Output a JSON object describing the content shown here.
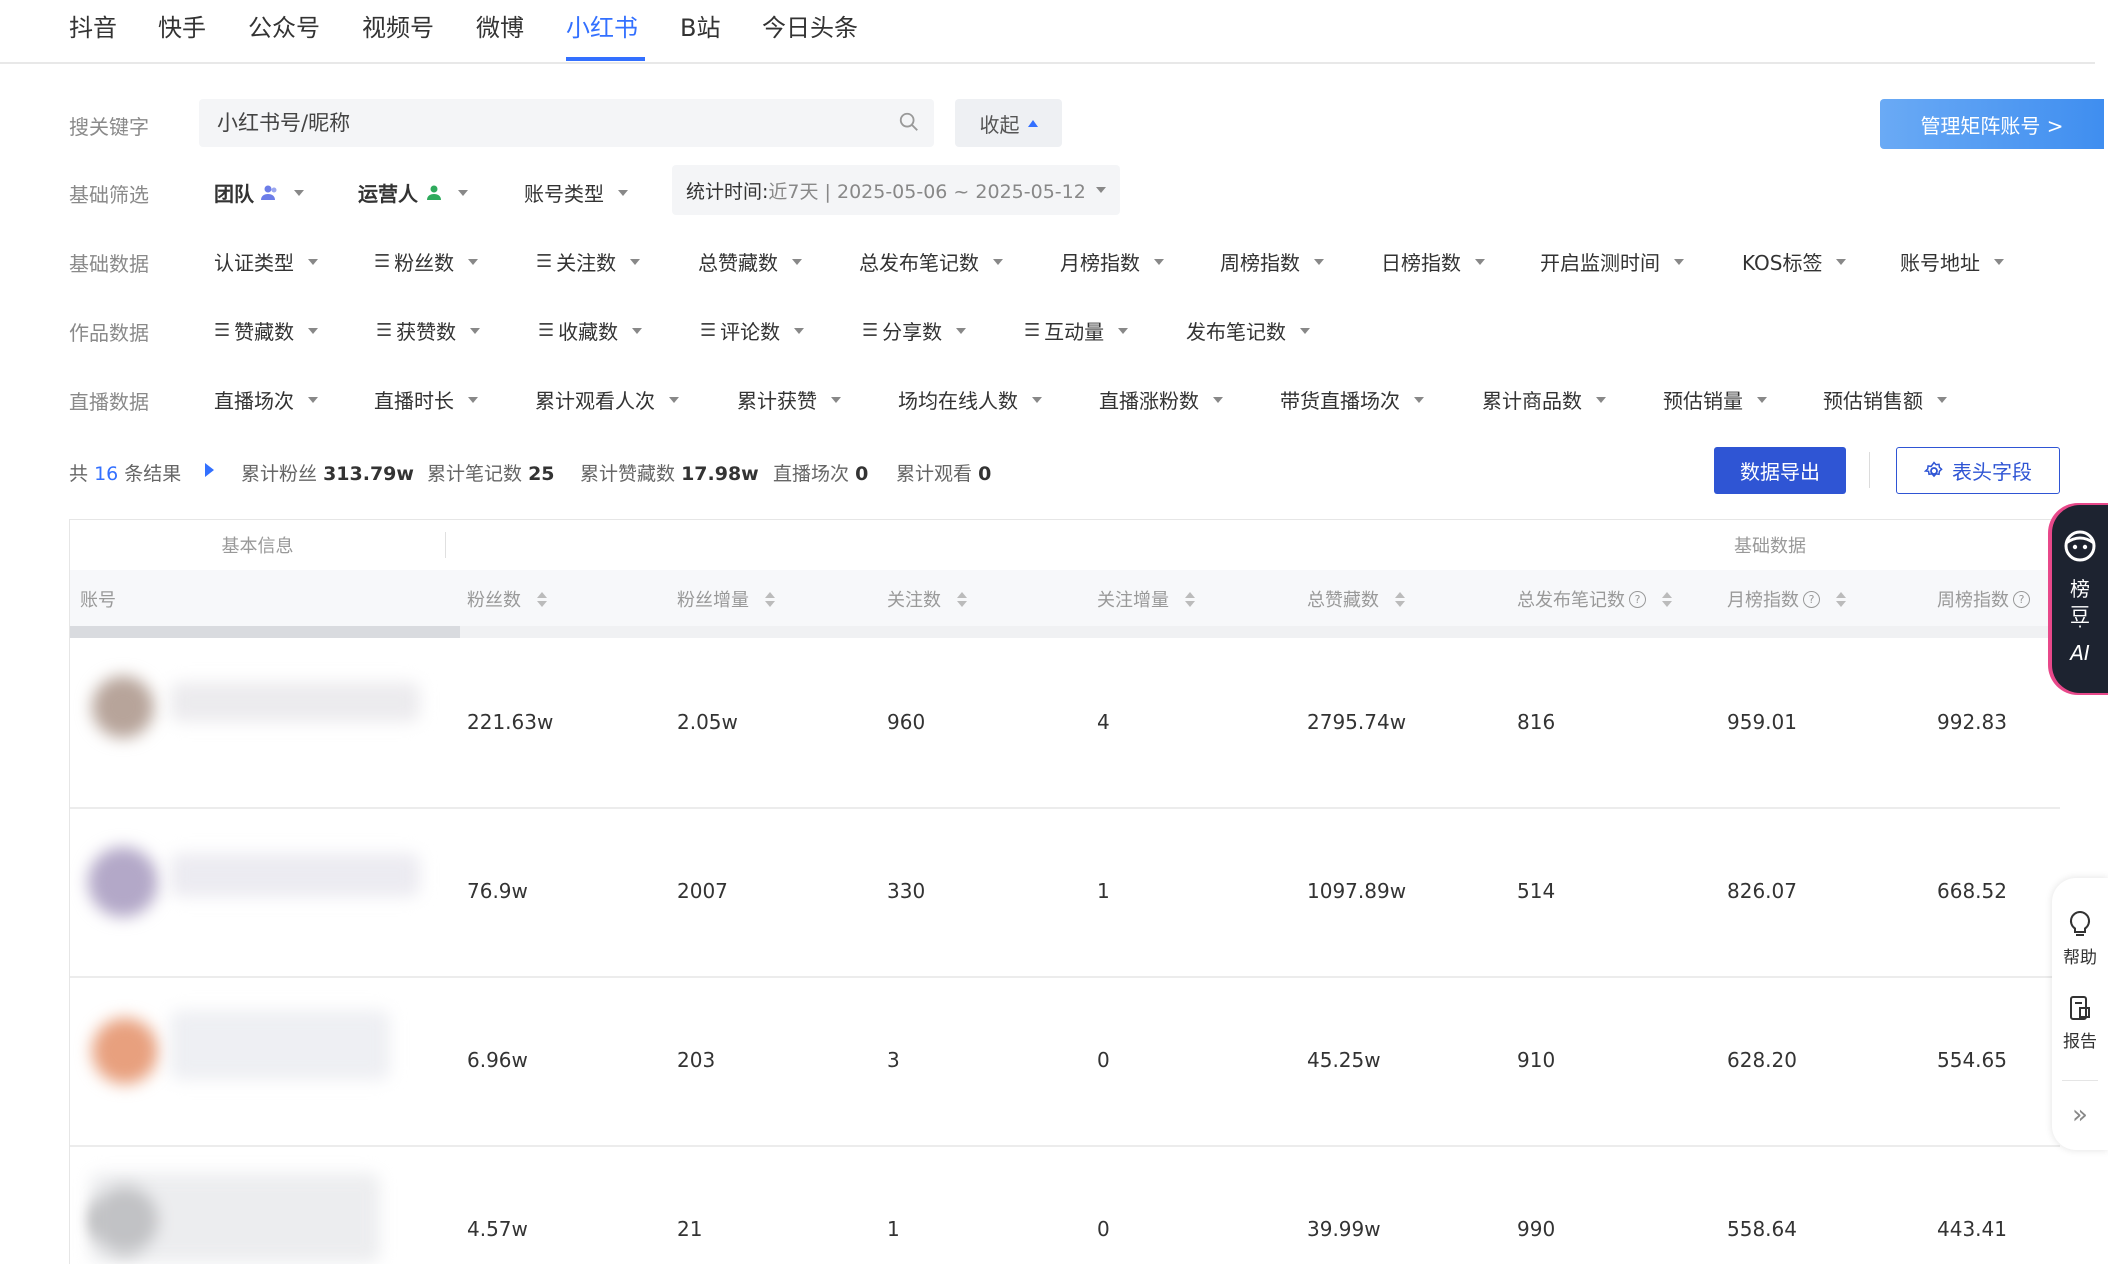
{
  "platform_tabs": [
    "抖音",
    "快手",
    "公众号",
    "视频号",
    "微博",
    "小红书",
    "B站",
    "今日头条"
  ],
  "active_tab": "小红书",
  "search": {
    "label": "搜关键字",
    "placeholder": "小红书号/昵称",
    "collapse_label": "收起"
  },
  "manage_button": "管理矩阵账号 >",
  "basic_filter": {
    "label": "基础筛选",
    "team": "团队",
    "operator": "运营人",
    "account_type": "账号类型",
    "date_label": "统计时间:",
    "date_value": "近7天 | 2025-05-06 ~ 2025-05-12"
  },
  "basic_data": {
    "label": "基础数据",
    "items": [
      "认证类型",
      "粉丝数",
      "关注数",
      "总赞藏数",
      "总发布笔记数",
      "月榜指数",
      "周榜指数",
      "日榜指数",
      "开启监测时间",
      "KOS标签",
      "账号地址"
    ]
  },
  "work_data": {
    "label": "作品数据",
    "items": [
      "赞藏数",
      "获赞数",
      "收藏数",
      "评论数",
      "分享数",
      "互动量",
      "发布笔记数"
    ]
  },
  "live_data": {
    "label": "直播数据",
    "items": [
      "直播场次",
      "直播时长",
      "累计观看人次",
      "累计获赞",
      "场均在线人数",
      "直播涨粉数",
      "带货直播场次",
      "累计商品数",
      "预估销量",
      "预估销售额"
    ]
  },
  "summary": {
    "total_prefix": "共",
    "total_count": "16",
    "total_suffix": "条结果",
    "fans_label": "累计粉丝",
    "fans_value": "313.79w",
    "notes_label": "累计笔记数",
    "notes_value": "25",
    "likes_label": "累计赞藏数",
    "likes_value": "17.98w",
    "live_label": "直播场次",
    "live_value": "0",
    "watch_label": "累计观看",
    "watch_value": "0"
  },
  "export_button": "数据导出",
  "fields_button": "表头字段",
  "table": {
    "group_basic": "基本信息",
    "group_data": "基础数据",
    "columns": [
      "账号",
      "粉丝数",
      "粉丝增量",
      "关注数",
      "关注增量",
      "总赞藏数",
      "总发布笔记数",
      "月榜指数",
      "周榜指数"
    ],
    "rows": [
      [
        "",
        "221.63w",
        "2.05w",
        "960",
        "4",
        "2795.74w",
        "816",
        "959.01",
        "992.83"
      ],
      [
        "",
        "76.9w",
        "2007",
        "330",
        "1",
        "1097.89w",
        "514",
        "826.07",
        "668.52"
      ],
      [
        "",
        "6.96w",
        "203",
        "3",
        "0",
        "45.25w",
        "910",
        "628.20",
        "554.65"
      ],
      [
        "",
        "4.57w",
        "21",
        "1",
        "0",
        "39.99w",
        "990",
        "558.64",
        "443.41"
      ]
    ]
  },
  "ai_panel": {
    "line1": "榜",
    "line2": "豆",
    "dot": "·",
    "line3": "AI"
  },
  "side_tools": {
    "help": "帮助",
    "report": "报告",
    "collapse": "»"
  }
}
